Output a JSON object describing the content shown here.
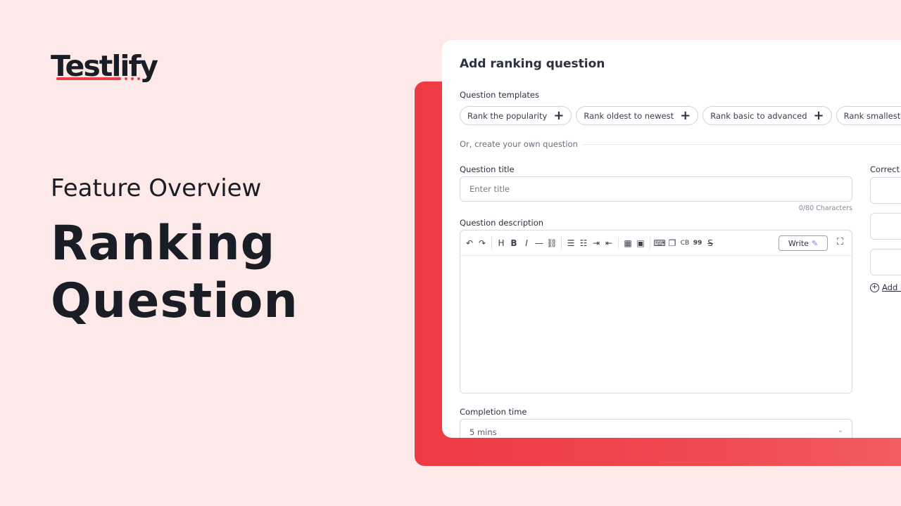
{
  "brand": {
    "name": "Testlify",
    "accent": "#ef3e4a"
  },
  "hero": {
    "subtitle": "Feature Overview",
    "title_line1": "Ranking",
    "title_line2": "Question"
  },
  "card": {
    "title": "Add ranking question",
    "templates_label": "Question templates",
    "templates": [
      "Rank the popularity",
      "Rank oldest to newest",
      "Rank basic to advanced",
      "Rank smallest to lar"
    ],
    "or_text": "Or, create your own question",
    "question_title": {
      "label": "Question title",
      "placeholder": "Enter title",
      "char_count": "0/80 Characters"
    },
    "question_description": {
      "label": "Question description",
      "write_label": "Write"
    },
    "toolbar_icons": [
      "undo-icon",
      "redo-icon",
      "heading-icon",
      "bold-icon",
      "italic-icon",
      "horizontal-rule-icon",
      "link-icon",
      "ordered-list-icon",
      "bullet-list-icon",
      "indent-icon",
      "outdent-icon",
      "table-icon",
      "image-icon",
      "code-icon",
      "copy-icon",
      "code-block-icon",
      "quote-icon",
      "strikethrough-icon",
      "expand-icon"
    ],
    "toolbar_glyphs": {
      "undo": "↶",
      "redo": "↷",
      "heading": "H",
      "bold": "B",
      "italic": "I",
      "hr": "—",
      "link": "⛓",
      "ol": "☰",
      "ul": "☷",
      "indent": "⇥",
      "outdent": "⇤",
      "table": "▦",
      "image": "▣",
      "code": "⌨",
      "copy": "❐",
      "codeblock": "CB",
      "quote": "99",
      "strike": "S",
      "expand": "⛶",
      "pen": "✎"
    },
    "completion_time": {
      "label": "Completion time",
      "value": "5 mins"
    },
    "right_column": {
      "label": "Correct",
      "add_option": "Add r"
    }
  }
}
